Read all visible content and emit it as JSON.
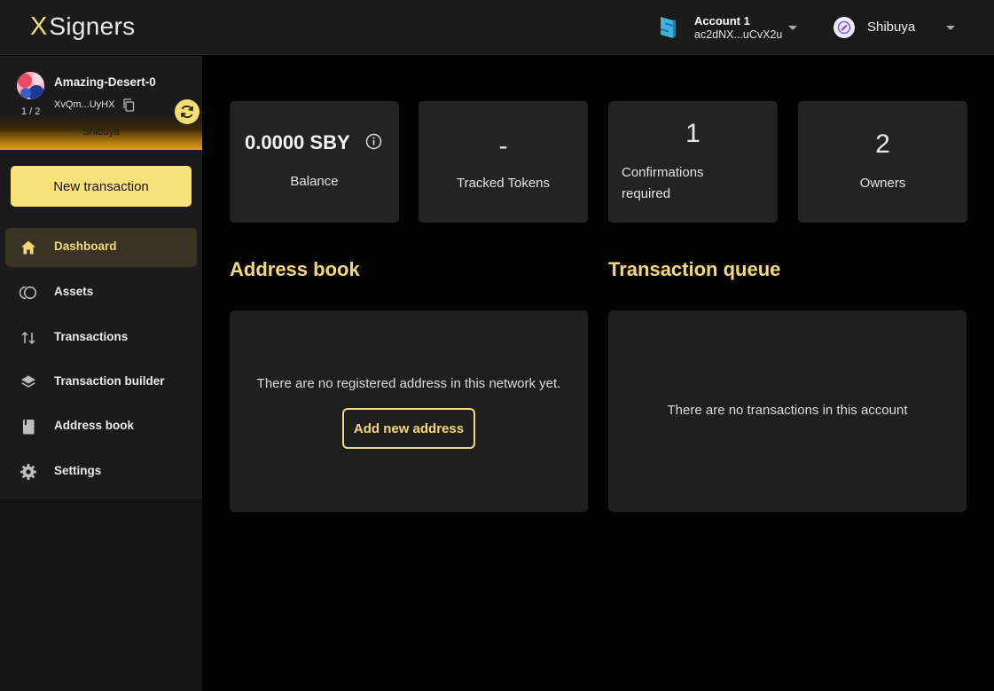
{
  "app": {
    "logo_x": "X",
    "logo_text": "Signers"
  },
  "header": {
    "account": {
      "name": "Account 1",
      "address": "ac2dNX...uCvX2u",
      "icon": "substrate-logo-icon"
    },
    "network": {
      "label": "Shibuya",
      "icon": "shibuya-network-icon"
    }
  },
  "safe": {
    "name": "Amazing-Desert-0",
    "address": "XvQm...UyHX",
    "threshold": "1 / 2",
    "network": "Shibuya",
    "avatar_icon": "identicon-avatar"
  },
  "sidebar": {
    "new_transaction_label": "New transaction",
    "items": [
      {
        "label": "Dashboard",
        "icon": "home-icon",
        "active": true
      },
      {
        "label": "Assets",
        "icon": "coins-icon",
        "active": false
      },
      {
        "label": "Transactions",
        "icon": "arrows-updown-icon",
        "active": false
      },
      {
        "label": "Transaction builder",
        "icon": "layers-icon",
        "active": false
      },
      {
        "label": "Address book",
        "icon": "book-icon",
        "active": false
      },
      {
        "label": "Settings",
        "icon": "gear-icon",
        "active": false
      }
    ]
  },
  "dashboard": {
    "balance": {
      "value": "0.0000 SBY",
      "label": "Balance"
    },
    "tracked_tokens": {
      "value": "-",
      "label": "Tracked Tokens"
    },
    "confirmations": {
      "value": "1",
      "label_line1": "Confirmations",
      "label_line2": "required"
    },
    "owners": {
      "value": "2",
      "label": "Owners"
    },
    "address_book": {
      "title": "Address book",
      "empty_text": "There are no registered address in this network yet.",
      "add_button_label": "Add new address"
    },
    "transaction_queue": {
      "title": "Transaction queue",
      "empty_text": "There are no transactions in this account"
    }
  },
  "colors": {
    "accent": "#f4d879",
    "button_yellow": "#f9e27a",
    "card_bg": "#232323",
    "sidebar_bg": "#1b1b1b",
    "active_nav_bg": "#3a3425"
  }
}
